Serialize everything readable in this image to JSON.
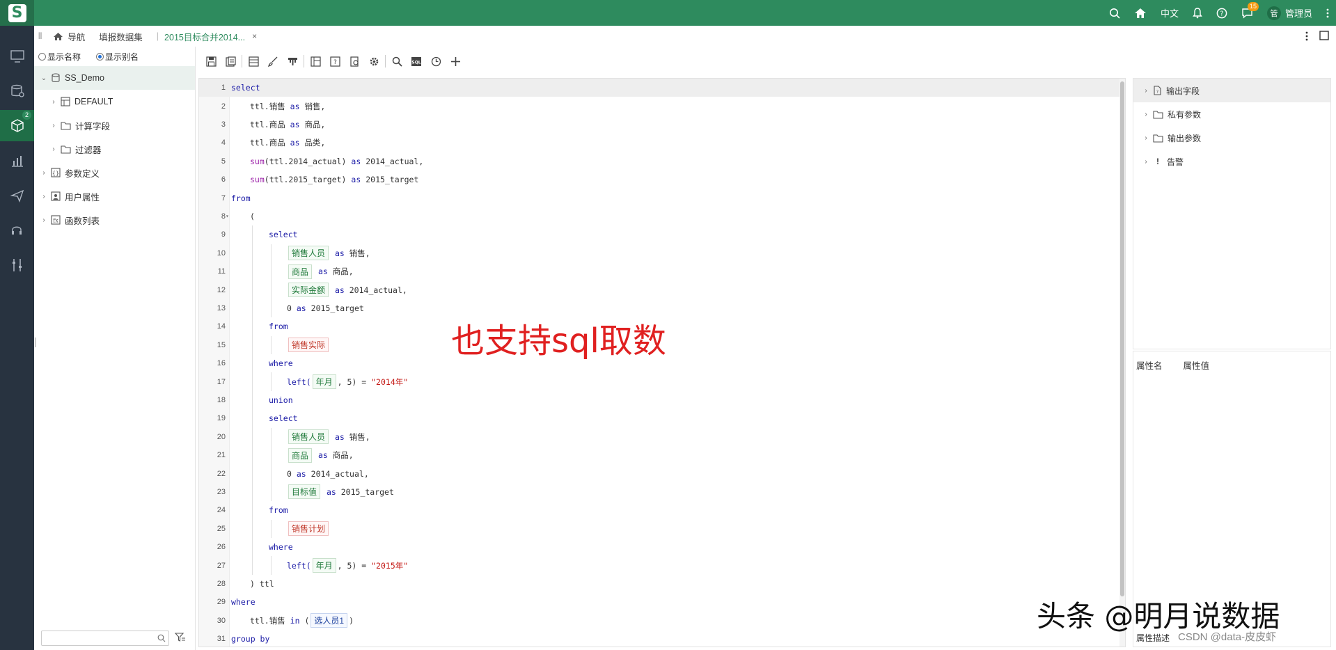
{
  "topbar": {
    "logo_letter": "S",
    "lang": "中文",
    "msg_count": "15",
    "user_initial": "管",
    "user_name": "管理员"
  },
  "leftnav": {
    "active_badge": "2",
    "items": [
      "monitor-icon",
      "database-icon",
      "cube-icon",
      "chart-icon",
      "send-icon",
      "headset-icon",
      "tools-icon"
    ]
  },
  "tabs": {
    "nav_label": "导航",
    "dataset_label": "填报数据集",
    "active_label": "2015目标合并2014...",
    "close": "×"
  },
  "tree": {
    "show_name": "显示名称",
    "show_alias": "显示别名",
    "root": "SS_Demo",
    "children": [
      "DEFAULT",
      "计算字段",
      "过滤器"
    ],
    "sections": [
      "参数定义",
      "用户属性",
      "函数列表"
    ]
  },
  "editor": {
    "lines": [
      {
        "n": "1"
      },
      {
        "n": "2"
      },
      {
        "n": "3"
      },
      {
        "n": "4"
      },
      {
        "n": "5"
      },
      {
        "n": "6"
      },
      {
        "n": "7"
      },
      {
        "n": "8"
      },
      {
        "n": "9"
      },
      {
        "n": "10"
      },
      {
        "n": "11"
      },
      {
        "n": "12"
      },
      {
        "n": "13"
      },
      {
        "n": "14"
      },
      {
        "n": "15"
      },
      {
        "n": "16"
      },
      {
        "n": "17"
      },
      {
        "n": "18"
      },
      {
        "n": "19"
      },
      {
        "n": "20"
      },
      {
        "n": "21"
      },
      {
        "n": "22"
      },
      {
        "n": "23"
      },
      {
        "n": "24"
      },
      {
        "n": "25"
      },
      {
        "n": "26"
      },
      {
        "n": "27"
      },
      {
        "n": "28"
      },
      {
        "n": "29"
      },
      {
        "n": "30"
      },
      {
        "n": "31"
      }
    ],
    "t": {
      "select": "select",
      "from": "from",
      "where": "where",
      "union": "union",
      "as": "as",
      "in": "in",
      "group_by": "group by",
      "l2": "ttl.销售",
      "l2b": "销售,",
      "l3": "ttl.商品",
      "l3b": "商品,",
      "l4": "ttl.商品",
      "l4b": "品类,",
      "sum": "sum",
      "l5a": "(ttl.2014_actual)",
      "l5b": "2014_actual,",
      "l6a": "(ttl.2015_target)",
      "l6b": "2015_target",
      "paren_open": "(",
      "tok_sales_person": "销售人员",
      "tok_product": "商品",
      "tok_actual_amount": "实际金额",
      "l10b": "销售,",
      "l11b": "商品,",
      "l12b": "2014_actual,",
      "l13a": "0",
      "l13b": "2015_target",
      "tok_sales_actual": "销售实际",
      "left": "left(",
      "tok_year_month": "年月",
      "l17b": ", 5) =",
      "str2014": "\"2014年\"",
      "l22a": "0",
      "l22b": "2014_actual,",
      "tok_target": "目标值",
      "l23b": "2015_target",
      "tok_sales_plan": "销售计划",
      "str2015": "\"2015年\"",
      "l28": ") ttl",
      "l30a": "ttl.销售",
      "l30b": "(",
      "tok_select_person": "选人员1",
      "l30c": ")"
    }
  },
  "overlay_text": "也支持sql取数",
  "right_panel": {
    "nodes": [
      "输出字段",
      "私有参数",
      "输出参数",
      "告警"
    ],
    "prop_name": "属性名",
    "prop_value": "属性值",
    "prop_desc": "属性描述"
  },
  "watermark": "头条 @明月说数据",
  "csdn": "CSDN @data-皮皮虾",
  "colors": {
    "brand": "#2e8b5e",
    "nav_bg": "#283340",
    "keyword": "#1a1aa6",
    "function": "#9b1fa8",
    "string": "#c41a16"
  }
}
